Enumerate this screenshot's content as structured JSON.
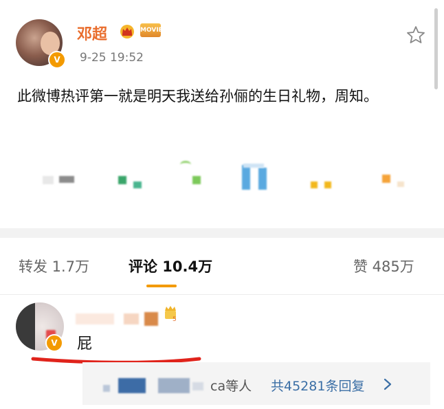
{
  "post": {
    "author_name": "邓超",
    "movie_badge": "MOVIE",
    "time": "9-25 19:52",
    "text": "此微博热评第一就是明天我送给孙俪的生日礼物，周知。"
  },
  "tabs": {
    "repost": "转发 1.7万",
    "comments": "评论 10.4万",
    "likes": "赞 485万"
  },
  "comment": {
    "text": "屁"
  },
  "replies": {
    "label": "ca等人",
    "count": "共45281条回复"
  },
  "colors": {
    "accent": "#f39a00",
    "author_name": "#e96d2d",
    "link": "#3a6ea5",
    "annotation_red": "#e0231b"
  },
  "icons": [
    "crown-icon",
    "movie-badge-icon",
    "star-icon",
    "verified-badge-icon",
    "chevron-right-icon",
    "level-badge-icon"
  ]
}
